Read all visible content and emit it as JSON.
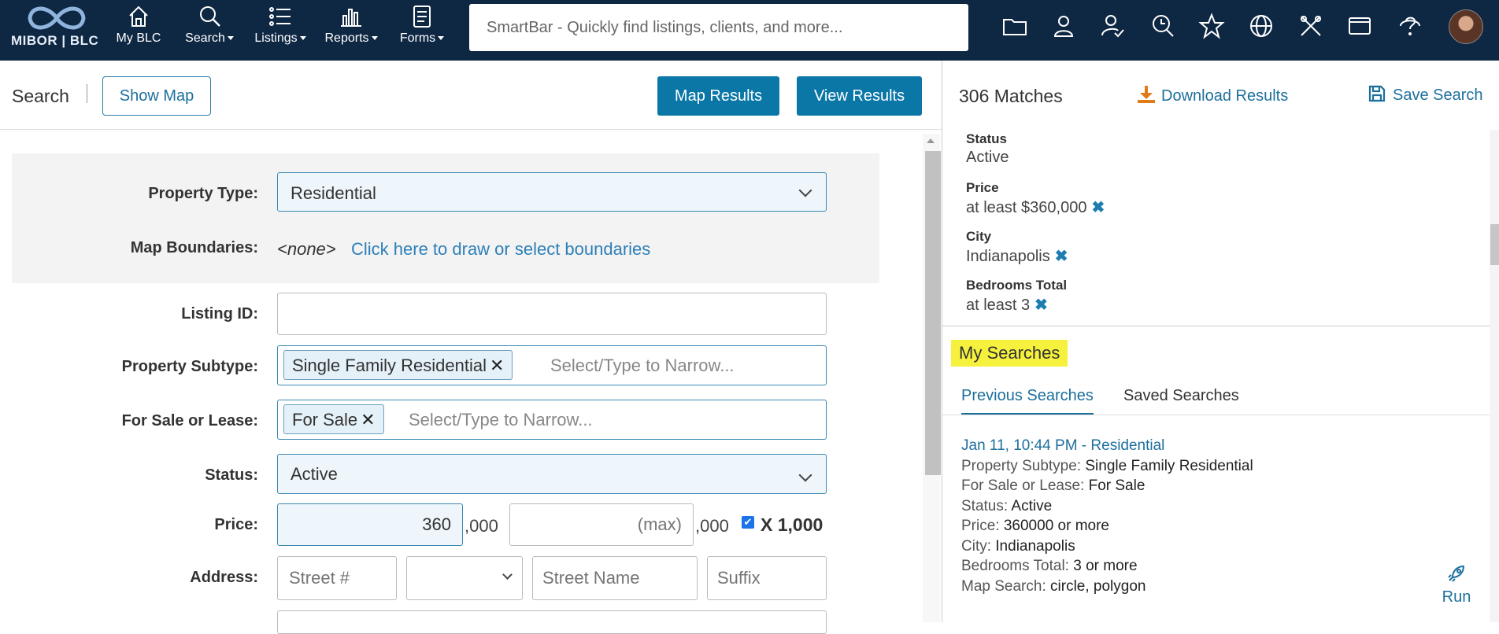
{
  "topbar": {
    "logo_text": "MIBOR | BLC",
    "nav": [
      {
        "label": "My BLC",
        "icon": "home-icon",
        "caret": false
      },
      {
        "label": "Search",
        "icon": "search-icon",
        "caret": true
      },
      {
        "label": "Listings",
        "icon": "list-icon",
        "caret": true
      },
      {
        "label": "Reports",
        "icon": "bar-chart-icon",
        "caret": true
      },
      {
        "label": "Forms",
        "icon": "document-icon",
        "caret": true
      }
    ],
    "smartbar_placeholder": "SmartBar - Quickly find listings, clients, and more...",
    "tool_icons": [
      "folder-icon",
      "contact-icon",
      "user-check-icon",
      "search-history-icon",
      "star-icon",
      "globe-icon",
      "tools-icon",
      "window-icon",
      "help-icon"
    ]
  },
  "toolbar": {
    "title": "Search",
    "show_map": "Show Map",
    "map_results": "Map Results",
    "view_results": "View Results"
  },
  "form": {
    "property_type": {
      "label": "Property Type:",
      "value": "Residential"
    },
    "map_boundaries": {
      "label": "Map Boundaries:",
      "none": "<none>",
      "link": "Click here to draw or select boundaries"
    },
    "listing_id": {
      "label": "Listing ID:",
      "value": ""
    },
    "property_subtype": {
      "label": "Property Subtype:",
      "chip": "Single Family Residential",
      "placeholder": "Select/Type to Narrow..."
    },
    "sale_lease": {
      "label": "For Sale or Lease:",
      "chip": "For Sale",
      "placeholder": "Select/Type to Narrow..."
    },
    "status": {
      "label": "Status:",
      "value": "Active"
    },
    "price": {
      "label": "Price:",
      "min": "360",
      "min_suffix": ",000",
      "max_placeholder": "(max)",
      "max_suffix": ",000",
      "multiplier_label": "X 1,000",
      "multiplier_checked": true
    },
    "address": {
      "label": "Address:",
      "street_no_placeholder": "Street #",
      "street_name_placeholder": "Street Name",
      "suffix_placeholder": "Suffix"
    }
  },
  "results": {
    "matches": "306 Matches",
    "download": "Download Results",
    "save": "Save Search",
    "criteria": [
      {
        "key": "Status",
        "value": "Active",
        "removable": false
      },
      {
        "key": "Price",
        "value": "at least $360,000",
        "removable": true
      },
      {
        "key": "City",
        "value": "Indianapolis",
        "removable": true
      },
      {
        "key": "Bedrooms Total",
        "value": "at least 3",
        "removable": true
      }
    ],
    "remove_glyph": "✖"
  },
  "my_searches": {
    "title": "My Searches",
    "tabs": [
      "Previous Searches",
      "Saved Searches"
    ],
    "entry": {
      "heading": "Jan 11, 10:44 PM - Residential",
      "lines": [
        {
          "k": "Property Subtype:",
          "v": "Single Family Residential"
        },
        {
          "k": "For Sale or Lease:",
          "v": "For Sale"
        },
        {
          "k": "Status:",
          "v": "Active"
        },
        {
          "k": "Price:",
          "v": "360000 or more"
        },
        {
          "k": "City:",
          "v": "Indianapolis"
        },
        {
          "k": "Bedrooms Total:",
          "v": "3 or more"
        },
        {
          "k": "Map Search:",
          "v": "circle, polygon"
        }
      ],
      "run_label": "Run"
    }
  },
  "colors": {
    "nav_bg": "#0e2743",
    "accent": "#0b77a6",
    "link": "#1d6f9c",
    "highlight": "#f5f13d",
    "download_icon": "#e07b1a"
  }
}
